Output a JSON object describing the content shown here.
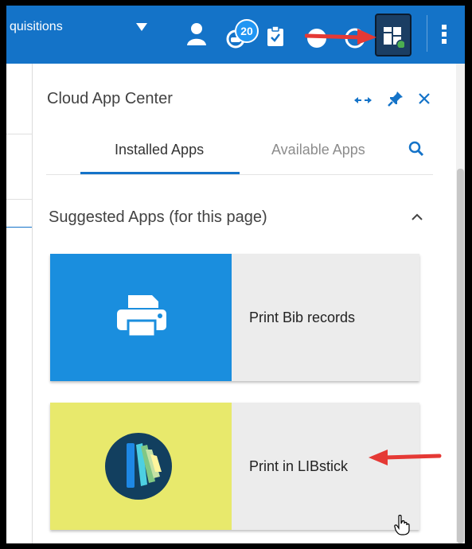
{
  "topbar": {
    "breadcrumb": "quisitions",
    "notification_count": "20",
    "icons": [
      "caret-down-icon",
      "user-icon",
      "notifications-icon",
      "tasks-icon",
      "help-icon",
      "cloud-apps-icon",
      "more-vertical-icon"
    ]
  },
  "panel": {
    "title": "Cloud App Center",
    "header_icons": [
      "expand-horizontal-icon",
      "pin-icon",
      "close-icon"
    ],
    "tabs": [
      {
        "label": "Installed Apps",
        "active": true
      },
      {
        "label": "Available Apps",
        "active": false
      }
    ],
    "section_title": "Suggested Apps (for this page)",
    "apps": [
      {
        "name": "Print Bib records",
        "icon": "printer-icon",
        "color": "#1a8ede"
      },
      {
        "name": "Print in LIBstick",
        "icon": "book-spine-label-icon",
        "color": "#e8e96c"
      }
    ]
  },
  "colors": {
    "topbar": "#1473c8",
    "accent": "#1473c8",
    "annotation_arrow": "#e53935",
    "status_dot": "#4caf50"
  }
}
